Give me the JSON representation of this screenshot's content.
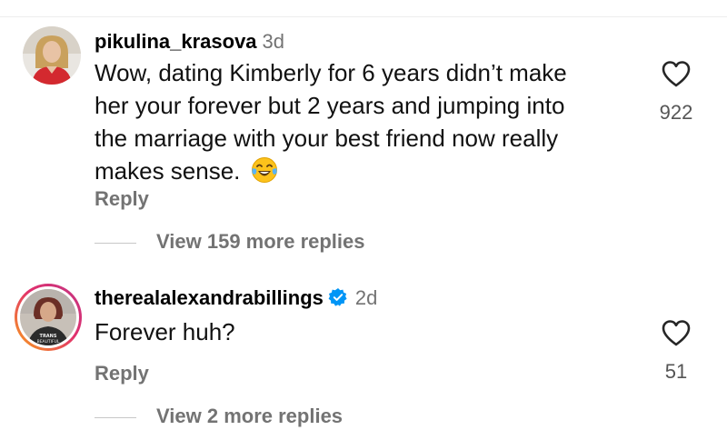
{
  "comments": [
    {
      "username": "pikulina_krasova",
      "time": "3d",
      "verified": false,
      "text_lines": [
        "Wow, dating Kimberly for 6 years didn’t make",
        "her your forever but 2 years and jumping into",
        "the marriage with your best friend now really",
        "makes sense."
      ],
      "emoji": "face-with-tears-of-joy-emoji",
      "like_count": "922",
      "reply_label": "Reply",
      "view_replies": "View 159 more replies"
    },
    {
      "username": "therealalexandrabillings",
      "time": "2d",
      "verified": true,
      "text_lines": [
        "Forever huh?"
      ],
      "avatar_shirt_text": "TRANS\nBEAUTIFUL",
      "like_count": "51",
      "reply_label": "Reply",
      "view_replies": "View 2 more replies"
    }
  ],
  "icons": {
    "like": "heart-outline-icon",
    "verified": "verified-badge-icon"
  },
  "colors": {
    "secondary_text": "#737373",
    "verified_blue": "#0095f6",
    "story_ring_start": "#f9a21a",
    "story_ring_end": "#d6249f"
  }
}
